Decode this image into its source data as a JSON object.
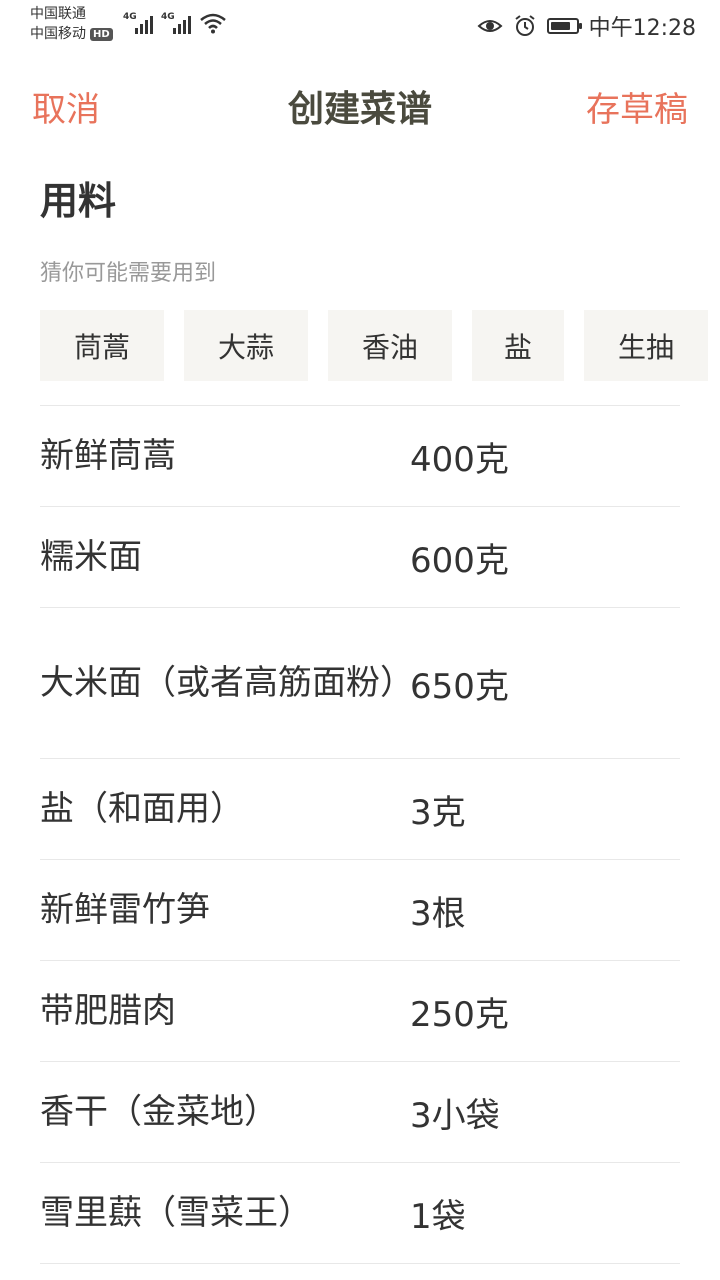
{
  "status_bar": {
    "carrier1": "中国联通",
    "carrier2": "中国移动",
    "hd": "HD",
    "net1": "4G",
    "net2": "4G",
    "battery_level": 0.8,
    "time": "中午12:28",
    "icons": [
      "eye-icon",
      "alarm-icon",
      "battery-icon",
      "wifi-icon",
      "signal-icon"
    ]
  },
  "header": {
    "cancel": "取消",
    "title": "创建菜谱",
    "save_draft": "存草稿"
  },
  "section": {
    "title": "用料",
    "hint": "猜你可能需要用到"
  },
  "suggestions": [
    "茼蒿",
    "大蒜",
    "香油",
    "盐",
    "生抽"
  ],
  "ingredients": [
    {
      "name": "新鲜茼蒿",
      "amount": "400克"
    },
    {
      "name": "糯米面",
      "amount": "600克"
    },
    {
      "name": "大米面（或者高筋面粉）",
      "amount": "650克"
    },
    {
      "name": "盐（和面用）",
      "amount": "3克"
    },
    {
      "name": "新鲜雷竹笋",
      "amount": "3根"
    },
    {
      "name": "带肥腊肉",
      "amount": "250克"
    },
    {
      "name": "香干（金菜地）",
      "amount": "3小袋"
    },
    {
      "name": "雪里蕻（雪菜王）",
      "amount": "1袋"
    }
  ],
  "colors": {
    "accent": "#e8735b",
    "title": "#4a4a3e",
    "chip_bg": "#f6f5f2",
    "divider": "#e8e8e8"
  }
}
